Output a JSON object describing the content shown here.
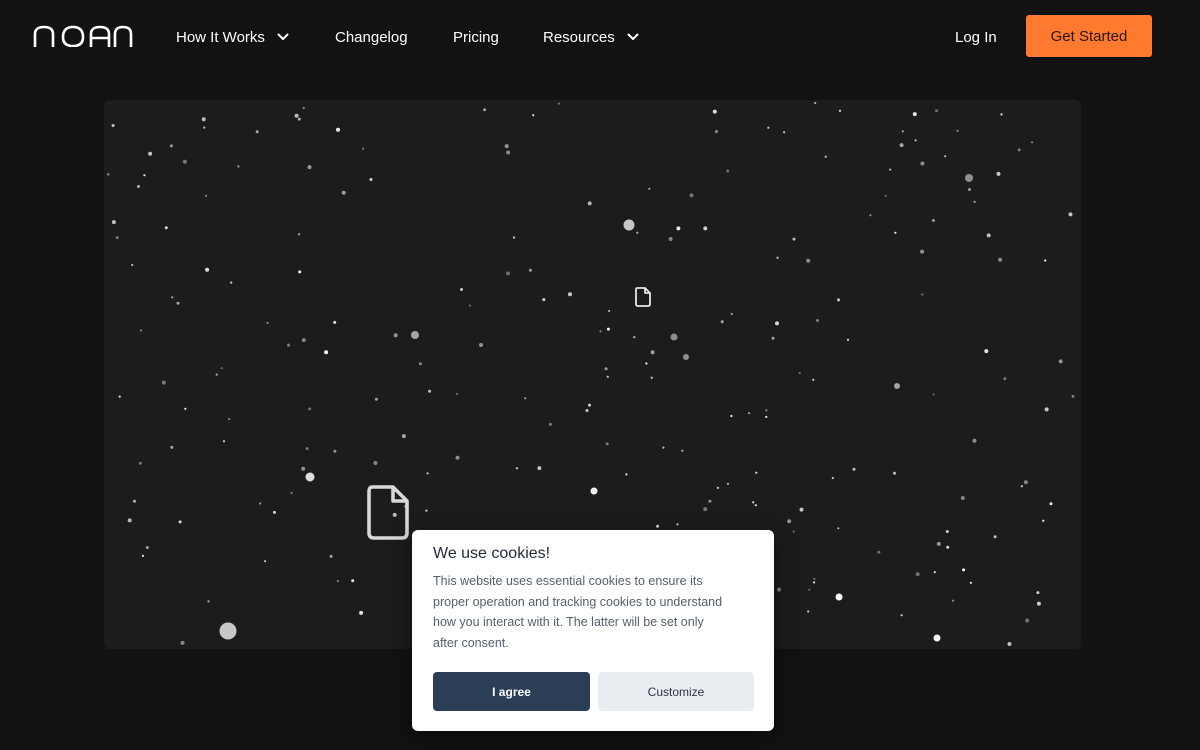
{
  "nav": {
    "logo_text": "noan",
    "items": [
      {
        "label": "How It Works",
        "has_dropdown": true
      },
      {
        "label": "Changelog",
        "has_dropdown": false
      },
      {
        "label": "Pricing",
        "has_dropdown": false
      },
      {
        "label": "Resources",
        "has_dropdown": true
      }
    ],
    "login_label": "Log In",
    "cta_label": "Get Started"
  },
  "hero": {
    "icons": [
      "document-icon",
      "document-icon"
    ]
  },
  "cookie": {
    "title": "We use cookies!",
    "text_lines": [
      "This website uses essential cookies to ensure its",
      "proper operation and tracking cookies to understand",
      "how you interact with it. The latter will be set only",
      "after consent."
    ],
    "agree_label": "I agree",
    "customize_label": "Customize"
  },
  "colors": {
    "background": "#121212",
    "panel": "#1c1c1c",
    "accent": "#ff7a2f",
    "agree_button": "#2b3e55"
  }
}
